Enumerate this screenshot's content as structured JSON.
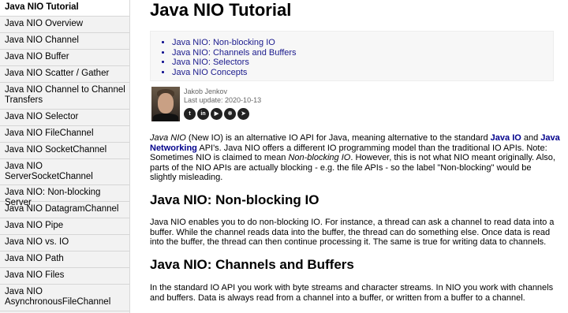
{
  "sidebar": {
    "items": [
      {
        "label": "Java NIO Tutorial",
        "active": true
      },
      {
        "label": "Java NIO Overview"
      },
      {
        "label": "Java NIO Channel"
      },
      {
        "label": "Java NIO Buffer"
      },
      {
        "label": "Java NIO Scatter / Gather"
      },
      {
        "label": "Java NIO Channel to Channel Transfers"
      },
      {
        "label": "Java NIO Selector"
      },
      {
        "label": "Java NIO FileChannel"
      },
      {
        "label": "Java NIO SocketChannel"
      },
      {
        "label": "Java NIO ServerSocketChannel"
      },
      {
        "label": "Java NIO: Non-blocking Server"
      },
      {
        "label": "Java NIO DatagramChannel"
      },
      {
        "label": "Java NIO Pipe"
      },
      {
        "label": "Java NIO vs. IO"
      },
      {
        "label": "Java NIO Path"
      },
      {
        "label": "Java NIO Files"
      },
      {
        "label": "Java NIO AsynchronousFileChannel"
      }
    ]
  },
  "main": {
    "title": "Java NIO Tutorial",
    "toc": [
      "Java NIO: Non-blocking IO",
      "Java NIO: Channels and Buffers",
      "Java NIO: Selectors",
      "Java NIO Concepts"
    ],
    "author": {
      "name": "Jakob Jenkov",
      "update_label": "Last update: 2020-10-13",
      "social_icons": [
        "twitter-icon",
        "linkedin-icon",
        "youtube-icon",
        "rss-icon",
        "telegram-icon"
      ]
    },
    "intro": {
      "t1": "Java NIO",
      "t2": " (New IO) is an alternative IO API for Java, meaning alternative to the standard ",
      "link1": "Java IO",
      "t3": " and ",
      "link2": "Java Networking",
      "t4": " API's. Java NIO offers a different IO programming model than the traditional IO APIs. Note: Sometimes NIO is claimed to mean ",
      "t5": "Non-blocking IO",
      "t6": ". However, this is not what NIO meant originally. Also, parts of the NIO APIs are actually blocking - e.g. the file APIs - so the label \"Non-blocking\" would be slightly misleading."
    },
    "section1": {
      "heading": "Java NIO: Non-blocking IO",
      "text": "Java NIO enables you to do non-blocking IO. For instance, a thread can ask a channel to read data into a buffer. While the channel reads data into the buffer, the thread can do something else. Once data is read into the buffer, the thread can then continue processing it. The same is true for writing data to channels."
    },
    "section2": {
      "heading": "Java NIO: Channels and Buffers",
      "text": "In the standard IO API you work with byte streams and character streams. In NIO you work with channels and buffers. Data is always read from a channel into a buffer, or written from a buffer to a channel."
    }
  }
}
